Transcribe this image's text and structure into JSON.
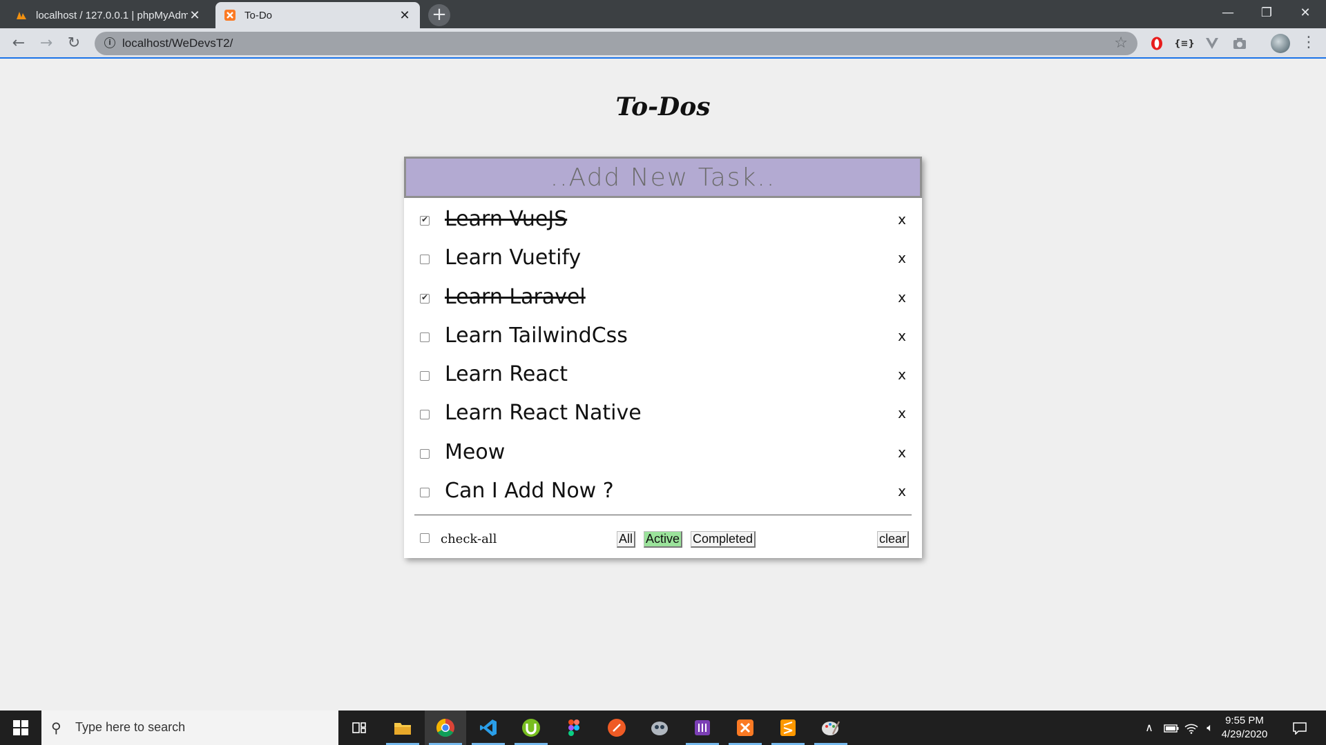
{
  "browser": {
    "tabs": [
      {
        "title": "localhost / 127.0.0.1 | phpMyAdmin",
        "favicon": "phpmyadmin-icon",
        "active": false
      },
      {
        "title": "To-Do",
        "favicon": "xampp-icon",
        "active": true
      }
    ],
    "address": "localhost/WeDevsT2/",
    "extensions": [
      "opera-icon",
      "json-icon",
      "vue-devtools-icon",
      "camera-icon"
    ]
  },
  "app": {
    "title": "To-Dos",
    "new_task_placeholder": "..Add New Task..",
    "todos": [
      {
        "text": "Learn VueJS",
        "done": true
      },
      {
        "text": "Learn Vuetify",
        "done": false
      },
      {
        "text": "Learn Laravel",
        "done": true
      },
      {
        "text": "Learn TailwindCss",
        "done": false
      },
      {
        "text": "Learn React",
        "done": false
      },
      {
        "text": "Learn React Native",
        "done": false
      },
      {
        "text": "Meow",
        "done": false
      },
      {
        "text": "Can I Add Now ?",
        "done": false
      }
    ],
    "delete_label": "x",
    "footer": {
      "check_all_label": "check-all",
      "filters": [
        {
          "label": "All",
          "active": false
        },
        {
          "label": "Active",
          "active": true
        },
        {
          "label": "Completed",
          "active": false
        }
      ],
      "clear_label": "clear"
    },
    "colors": {
      "header": "#b3aad2",
      "active_filter": "#9be39b"
    }
  },
  "taskbar": {
    "search_placeholder": "Type here to search",
    "apps": [
      "task-view-icon",
      "file-explorer-icon",
      "chrome-icon",
      "vscode-icon",
      "utorrent-icon",
      "figma-icon",
      "postman-icon",
      "unknown-app-icon",
      "purple-app-icon",
      "xampp-icon",
      "sublime-icon",
      "paint-icon"
    ],
    "time": "9:55 PM",
    "date": "4/29/2020"
  }
}
